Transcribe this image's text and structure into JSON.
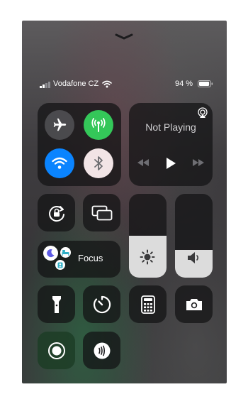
{
  "status_bar": {
    "carrier": "Vodafone CZ",
    "battery_percent": "94 %",
    "signal_bars": 2,
    "battery_level": 0.94
  },
  "connectivity": {
    "airplane": {
      "icon": "airplane-icon",
      "on": false
    },
    "cellular": {
      "icon": "cellular-antenna-icon",
      "on": true,
      "color": "#34c759"
    },
    "wifi": {
      "icon": "wifi-icon",
      "on": true,
      "color": "#0a84ff"
    },
    "bluetooth": {
      "icon": "bluetooth-icon",
      "on": false
    }
  },
  "media": {
    "title": "Not Playing",
    "airplay_icon": "airplay-icon",
    "controls": [
      "rewind-icon",
      "play-icon",
      "fast-forward-icon"
    ]
  },
  "controls": {
    "rotation_lock": "rotation-lock-icon",
    "screen_mirroring": "screen-mirroring-icon",
    "focus_label": "Focus",
    "brightness_level": 0.5,
    "volume_level": 0.33,
    "flashlight": "flashlight-icon",
    "timer": "timer-icon",
    "calculator": "calculator-icon",
    "camera": "camera-icon",
    "screen_recording": "screen-record-icon",
    "nfc_reader": "nfc-reader-icon"
  },
  "colors": {
    "green_on": "#34c759",
    "blue_on": "#0a84ff"
  }
}
